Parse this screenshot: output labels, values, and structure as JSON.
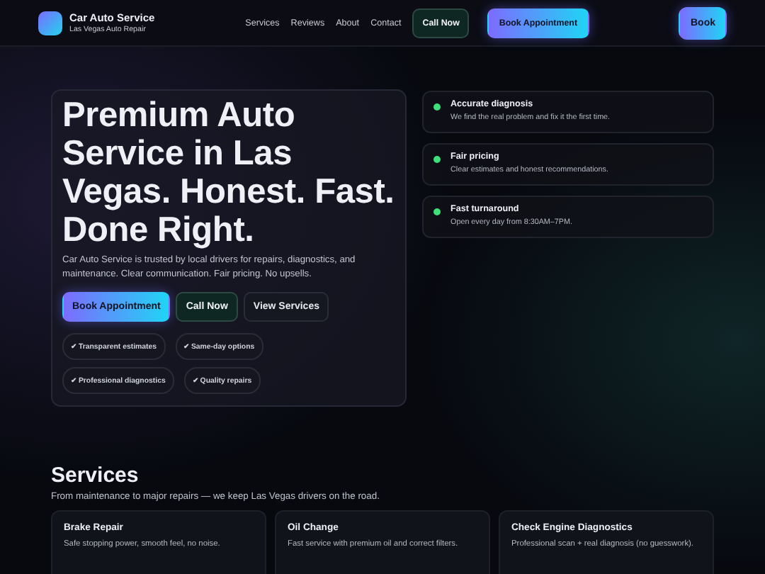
{
  "header": {
    "brand": "Car Auto Service",
    "tagline": "Las Vegas Auto Repair",
    "nav": [
      "Services",
      "Reviews",
      "About",
      "Contact"
    ],
    "actions": [
      {
        "label": "Call Now",
        "kind": "dark"
      },
      {
        "label": "Book Appointment",
        "kind": "primary"
      }
    ],
    "book": "Book"
  },
  "hero": {
    "title": "Premium Auto Service in Las Vegas. Honest. Fast. Done Right.",
    "text": "Car Auto Service is trusted by local drivers for repairs, diagnostics, and maintenance. Clear communication. Fair pricing. No upsells.",
    "buttons": [
      {
        "label": "Book Appointment",
        "kind": "primary"
      },
      {
        "label": "Call Now",
        "kind": "dark"
      },
      {
        "label": "View Services",
        "kind": "ghost"
      }
    ],
    "chips": [
      "✔ Transparent estimates",
      "✔ Same-day options",
      "✔ Professional diagnostics",
      "✔ Quality repairs"
    ]
  },
  "features": [
    {
      "title": "Accurate diagnosis",
      "text": "We find the real problem and fix it the first time.",
      "color": "#3ee07a"
    },
    {
      "title": "Fair pricing",
      "text": "Clear estimates and honest recommendations.",
      "color": "#3ee07a"
    },
    {
      "title": "Fast turnaround",
      "text": "Open every day from 8:30AM–7PM.",
      "color": "#3ee07a"
    }
  ],
  "services": {
    "title": "Services",
    "subtitle": "From maintenance to major repairs — we keep Las Vegas drivers on the road.",
    "cards": [
      {
        "title": "Brake Repair",
        "text": "Safe stopping power, smooth feel, no noise."
      },
      {
        "title": "Oil Change",
        "text": "Fast service with premium oil and correct filters."
      },
      {
        "title": "Check Engine Diagnostics",
        "text": "Professional scan + real diagnosis (no guesswork)."
      }
    ]
  }
}
